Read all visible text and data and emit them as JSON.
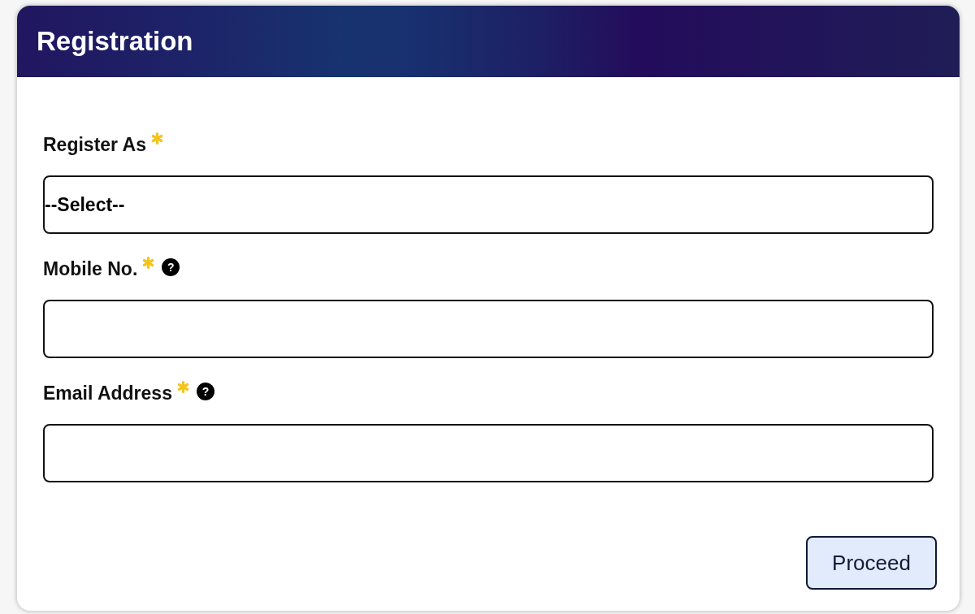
{
  "card": {
    "title": "Registration",
    "fields": [
      {
        "kind": "select",
        "label": "Register As",
        "required": true,
        "value": "--Select--"
      },
      {
        "kind": "text",
        "label": "Mobile No.",
        "required": true,
        "help": "?"
      },
      {
        "kind": "text",
        "label": "Email Address",
        "required": true,
        "help": "?"
      }
    ],
    "submit_button": {
      "label": "Proceed"
    }
  }
}
